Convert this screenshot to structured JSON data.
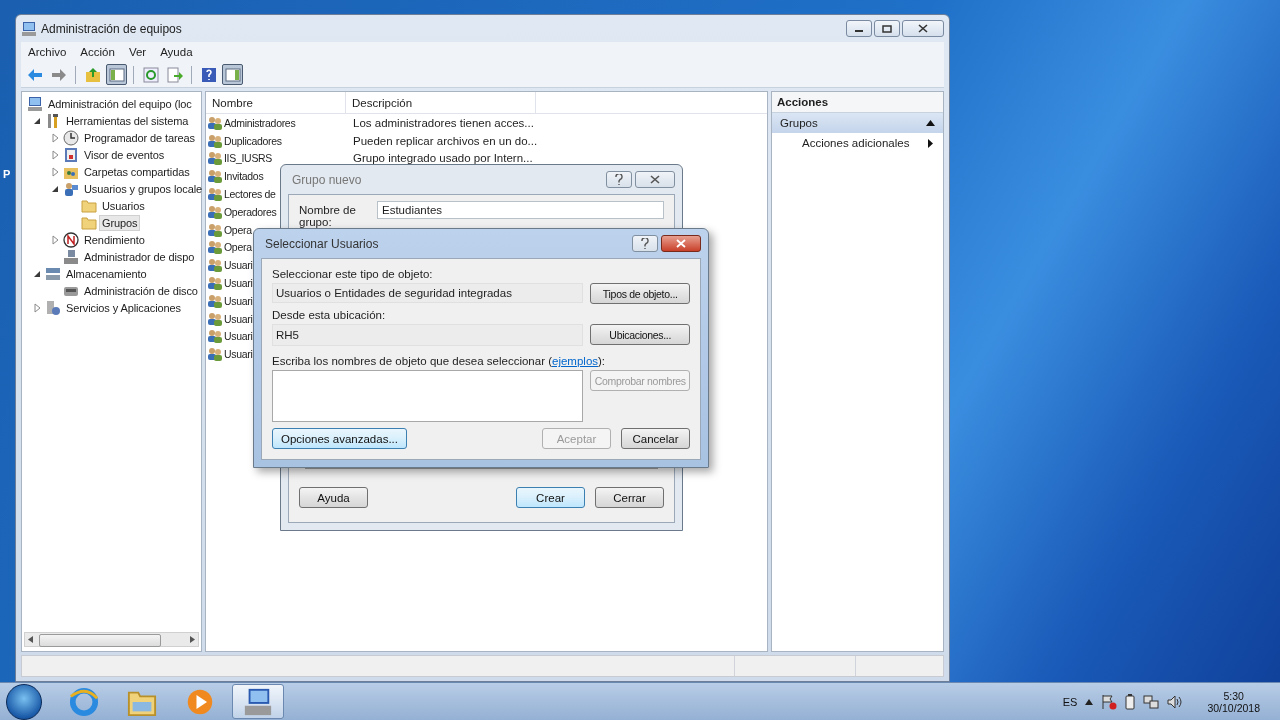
{
  "desktop": {
    "icon_label": "P"
  },
  "window": {
    "title": "Administración de equipos"
  },
  "menu": [
    "Archivo",
    "Acción",
    "Ver",
    "Ayuda"
  ],
  "toolbar": [
    [
      {
        "kind": "back",
        "pressed": false
      },
      {
        "kind": "forward",
        "pressed": false
      }
    ],
    [
      {
        "kind": "up",
        "pressed": false
      },
      {
        "kind": "tree",
        "pressed": true
      }
    ],
    [
      {
        "kind": "refresh",
        "pressed": false
      },
      {
        "kind": "export",
        "pressed": false
      }
    ],
    [
      {
        "kind": "help",
        "pressed": false
      },
      {
        "kind": "actions",
        "pressed": true
      }
    ]
  ],
  "tree": [
    {
      "label": "Administración del equipo (loc",
      "kind": "computer",
      "selected": false,
      "children": [
        {
          "label": "Herramientas del sistema",
          "kind": "tools",
          "expanded": true,
          "selected": false,
          "children": [
            {
              "label": "Programador de tareas",
              "kind": "clock",
              "expanded": false,
              "selected": false
            },
            {
              "label": "Visor de eventos",
              "kind": "events",
              "expanded": false,
              "selected": false
            },
            {
              "label": "Carpetas compartidas",
              "kind": "share",
              "expanded": false,
              "selected": false
            },
            {
              "label": "Usuarios y grupos locale",
              "kind": "users",
              "expanded": true,
              "selected": false,
              "children": [
                {
                  "label": "Usuarios",
                  "kind": "folder",
                  "selected": false
                },
                {
                  "label": "Grupos",
                  "kind": "folder",
                  "selected": true
                }
              ]
            },
            {
              "label": "Rendimiento",
              "kind": "perf",
              "expanded": false,
              "selected": false
            },
            {
              "label": "Administrador de dispo",
              "kind": "device",
              "selected": false
            }
          ]
        },
        {
          "label": "Almacenamiento",
          "kind": "storage",
          "expanded": true,
          "selected": false,
          "children": [
            {
              "label": "Administración de disco",
              "kind": "disk",
              "selected": false
            }
          ]
        },
        {
          "label": "Servicios y Aplicaciones",
          "kind": "services",
          "expanded": false,
          "selected": false
        }
      ]
    }
  ],
  "list": {
    "columns": [
      "Nombre",
      "Descripción"
    ],
    "rows": [
      {
        "name": "Administradores",
        "description": "Los administradores tienen acces..."
      },
      {
        "name": "Duplicadores",
        "description": "Pueden replicar archivos en un do..."
      },
      {
        "name": "IIS_IUSRS",
        "description": "Grupo integrado usado por Intern..."
      },
      {
        "name": "Invitados"
      },
      {
        "name": "Lectores de"
      },
      {
        "name": "Operadores"
      },
      {
        "name": "Opera"
      },
      {
        "name": "Opera"
      },
      {
        "name": "Usuari"
      },
      {
        "name": "Usuari"
      },
      {
        "name": "Usuari"
      },
      {
        "name": "Usuari"
      },
      {
        "name": "Usuari"
      },
      {
        "name": "Usuari"
      }
    ]
  },
  "actions": {
    "header": "Acciones",
    "section": {
      "label": "Grupos",
      "expanded": true
    },
    "items": [
      {
        "label": "Acciones adicionales"
      }
    ]
  },
  "new_group_dialog": {
    "title": "Grupo nuevo",
    "active": false,
    "name_label": "Nombre de grupo:",
    "name_value": "Estudiantes",
    "buttons": [
      {
        "label": "Ayuda",
        "default": false
      },
      {
        "label": "Crear",
        "default": true
      },
      {
        "label": "Cerrar",
        "default": false
      }
    ]
  },
  "select_users_dialog": {
    "title": "Seleccionar Usuarios",
    "active": true,
    "object_type_label": "Seleccionar este tipo de objeto:",
    "object_type_value": "Usuarios o Entidades de seguridad integradas",
    "object_type_button": "Tipos de objeto...",
    "location_label": "Desde esta ubicación:",
    "location_value": "RH5",
    "location_button": "Ubicaciones...",
    "names_label_before": "Escriba los nombres de objeto que desea seleccionar (",
    "names_link": "ejemplos",
    "names_label_after": "):",
    "check_button": {
      "label": "Comprobar nombres",
      "disabled": true
    },
    "buttons": [
      {
        "label": "Opciones avanzadas...",
        "disabled": false,
        "hovered": true
      },
      {
        "label": "Aceptar",
        "disabled": true,
        "hovered": false
      },
      {
        "label": "Cancelar",
        "disabled": false,
        "hovered": false
      }
    ]
  },
  "taskbar": {
    "apps": [
      {
        "kind": "browser",
        "selected": false
      },
      {
        "kind": "folder",
        "selected": false
      },
      {
        "kind": "media",
        "selected": false
      },
      {
        "kind": "admin",
        "selected": true
      }
    ],
    "language": "ES",
    "time": "5:30",
    "date": "30/10/2018"
  }
}
